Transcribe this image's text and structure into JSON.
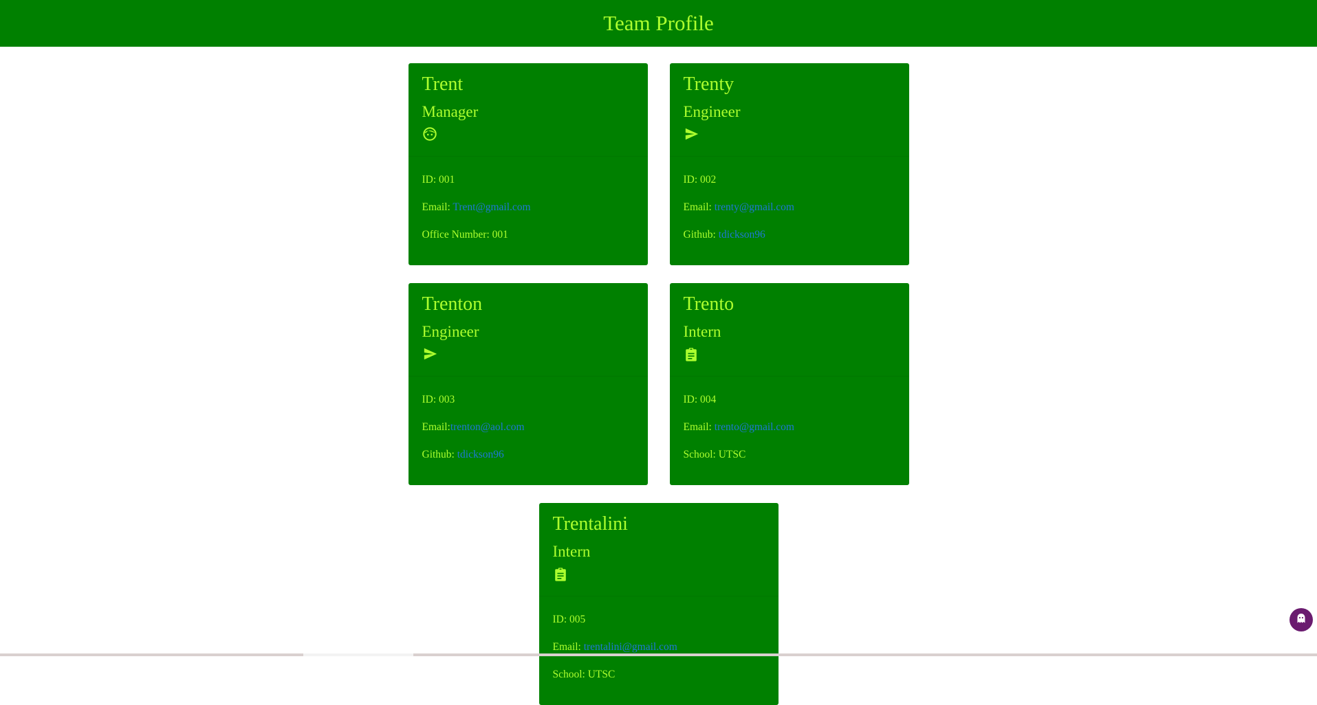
{
  "header": {
    "title": "Team Profile"
  },
  "colors": {
    "header_bg": "#008000",
    "card_bg": "#008000",
    "text": "#adff2f",
    "link": "#1e78d6",
    "float_button": "#6a1b6f"
  },
  "cards": [
    {
      "name": "Trent",
      "role": "Manager",
      "icon": "face-icon",
      "id_label": "ID: 001",
      "email_label": "Email: ",
      "email": "Trent@gmail.com",
      "extra_label": "Office Number: 001",
      "extra_link": ""
    },
    {
      "name": "Trenty",
      "role": "Engineer",
      "icon": "send-icon",
      "id_label": "ID: 002",
      "email_label": "Email: ",
      "email": "trenty@gmail.com",
      "extra_label": "Github: ",
      "extra_link": "tdickson96"
    },
    {
      "name": "Trenton",
      "role": "Engineer",
      "icon": "send-icon",
      "id_label": "ID: 003",
      "email_label": "Email:",
      "email": "trenton@aol.com",
      "extra_label": "Github: ",
      "extra_link": "tdickson96"
    },
    {
      "name": "Trento",
      "role": "Intern",
      "icon": "clipboard-icon",
      "id_label": "ID: 004",
      "email_label": "Email: ",
      "email": "trento@gmail.com",
      "extra_label": "School: UTSC",
      "extra_link": ""
    },
    {
      "name": "Trentalini",
      "role": "Intern",
      "icon": "clipboard-icon",
      "id_label": "ID: 005",
      "email_label": "Email: ",
      "email": "trentalini@gmail.com",
      "extra_label": "School: UTSC",
      "extra_link": ""
    }
  ],
  "float_button": {
    "icon": "ghost-icon"
  }
}
